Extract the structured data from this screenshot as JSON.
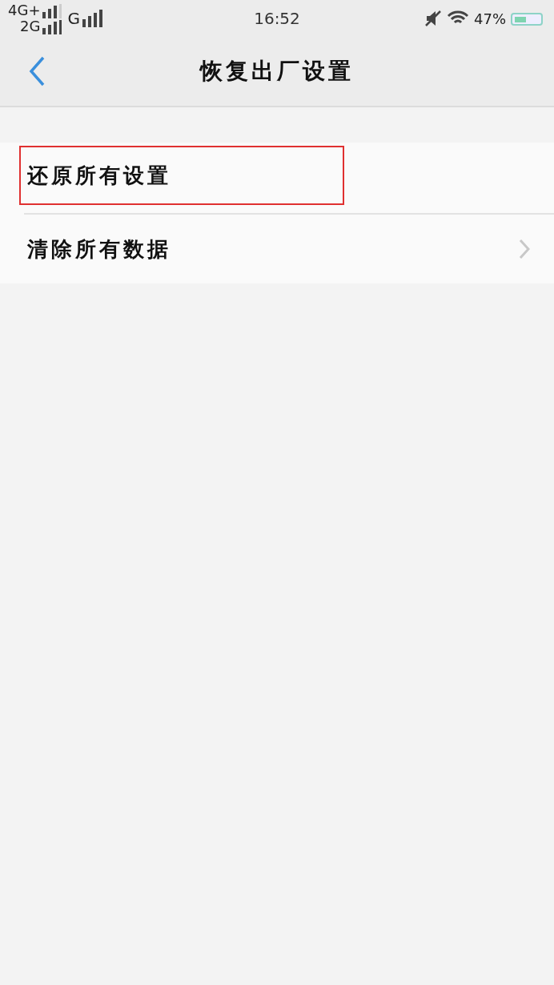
{
  "status_bar": {
    "network_1": "4G+",
    "network_2": "2G",
    "network_3": "G",
    "time": "16:52",
    "battery": "47%"
  },
  "header": {
    "title": "恢复出厂设置"
  },
  "items": [
    {
      "label": "还原所有设置",
      "chevron": false,
      "highlighted": true
    },
    {
      "label": "清除所有数据",
      "chevron": true,
      "highlighted": false
    }
  ]
}
